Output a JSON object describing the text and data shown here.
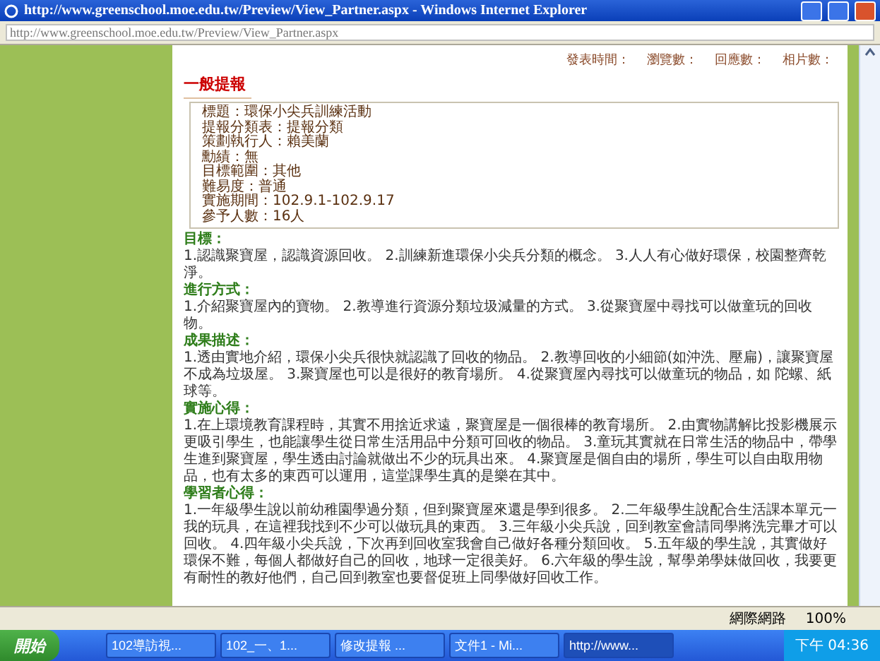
{
  "window": {
    "title": "http://www.greenschool.moe.edu.tw/Preview/View_Partner.aspx - Windows Internet Explorer"
  },
  "address_bar": {
    "url": "http://www.greenschool.moe.edu.tw/Preview/View_Partner.aspx"
  },
  "meta": [
    "發表時間：",
    "瀏覽數：",
    "回應數：",
    "相片數："
  ],
  "report": {
    "heading": "一般提報",
    "fields": [
      {
        "label": "標題：",
        "value": "環保小尖兵訓練活動"
      },
      {
        "label": "提報分類表：",
        "value": "提報分類"
      },
      {
        "label": "策劃執行人：",
        "value": "賴美蘭"
      },
      {
        "label": "勳績：",
        "value": "無"
      },
      {
        "label": "目標範圍：",
        "value": "其他"
      },
      {
        "label": "難易度：",
        "value": "普通"
      },
      {
        "label": "實施期間：",
        "value": "102.9.1-102.9.17"
      },
      {
        "label": "參予人數：",
        "value": "16人"
      }
    ]
  },
  "sections": [
    {
      "title": "目標：",
      "text": "1.認識聚寶屋，認識資源回收。 2.訓練新進環保小尖兵分類的概念。 3.人人有心做好環保，校園整齊乾淨。"
    },
    {
      "title": "進行方式：",
      "text": "1.介紹聚寶屋內的寶物。 2.教導進行資源分類垃圾減量的方式。 3.從聚寶屋中尋找可以做童玩的回收物。"
    },
    {
      "title": "成果描述：",
      "text": "1.透由實地介紹，環保小尖兵很快就認識了回收的物品。 2.教導回收的小細節(如沖洗、壓扁)，讓聚寶屋不成為垃圾屋。 3.聚寶屋也可以是很好的教育場所。 4.從聚寶屋內尋找可以做童玩的物品，如 陀螺、紙球等。"
    },
    {
      "title": "實施心得：",
      "text": "1.在上環境教育課程時，其實不用捨近求遠，聚寶屋是一個很棒的教育場所。 2.由實物講解比投影機展示更吸引學生，也能讓學生從日常生活用品中分類可回收的物品。 3.童玩其實就在日常生活的物品中，帶學生進到聚寶屋，學生透由討論就做出不少的玩具出來。 4.聚寶屋是個自由的場所，學生可以自由取用物品，也有太多的東西可以運用，這堂課學生真的是樂在其中。"
    },
    {
      "title": "學習者心得：",
      "text": "1.一年級學生說以前幼稚園學過分類，但到聚寶屋來還是學到很多。 2.二年級學生說配合生活課本單元一我的玩具，在這裡我找到不少可以做玩具的東西。 3.三年級小尖兵說，回到教室會請同學將洗完畢才可以回收。 4.四年級小尖兵說，下次再到回收室我會自己做好各種分類回收。 5.五年級的學生說，其實做好環保不難，每個人都做好自己的回收，地球一定很美好。 6.六年級的學生說，幫學弟學妹做回收，我要更有耐性的教好他們，自己回到教室也要督促班上同學做好回收工作。"
    }
  ],
  "status_bar": {
    "zone": "網際網路",
    "zoom": "100%"
  },
  "taskbar": {
    "start": "開始",
    "tasks": [
      {
        "label": "102導訪視...",
        "selected": false
      },
      {
        "label": "102_一、1...",
        "selected": false
      },
      {
        "label": "修改提報 ...",
        "selected": false
      },
      {
        "label": "文件1 - Mi...",
        "selected": false
      },
      {
        "label": "http://www...",
        "selected": true
      }
    ],
    "clock": "下午 04:36"
  }
}
